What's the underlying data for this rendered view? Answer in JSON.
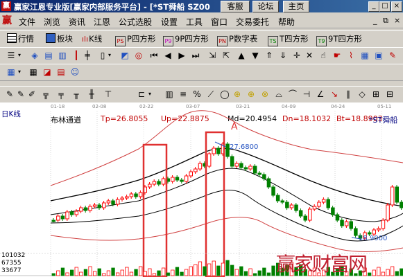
{
  "window": {
    "title": "赢家江恩专业版[赢家内部服务平台] - [*ST舜船   SZ00",
    "title_buttons": [
      "客服",
      "论坛",
      "主页"
    ],
    "window_controls": [
      "_",
      "□",
      "×"
    ]
  },
  "menu": {
    "items": [
      "文件",
      "浏览",
      "资讯",
      "江恩",
      "公式选股",
      "设置",
      "工具",
      "窗口",
      "交易委托",
      "帮助"
    ],
    "window_controls": [
      "_",
      "⧉",
      "×"
    ]
  },
  "toolbar1": {
    "items": [
      {
        "icon": "grid-icon",
        "label": "行情"
      },
      {
        "icon": "blocks-icon",
        "label": "板块"
      },
      {
        "icon": "kline-icon",
        "label": "K线"
      },
      {
        "icon": "ps-icon",
        "badge": "PS",
        "label": "P四方形"
      },
      {
        "icon": "p9-icon",
        "badge": "P9",
        "label": "9P四方形"
      },
      {
        "icon": "pn-icon",
        "badge": "PN",
        "label": "P数字表"
      },
      {
        "icon": "ts-icon",
        "badge": "TS",
        "label": "T四方形"
      },
      {
        "icon": "t9-icon",
        "badge": "T9",
        "label": "9T四方形"
      }
    ]
  },
  "chart": {
    "period_label": "日K线",
    "dates": [
      "01-18",
      "02-08",
      "02-22",
      "03-07",
      "03-21",
      "04-09",
      "04-24",
      "05-11"
    ],
    "indicator_name": "布林通道",
    "tp": "Tp=26.8055",
    "up": "Up=22.8875",
    "md": "Md=20.4954",
    "dn": "Dn=18.1032",
    "bt": "Bt=18.8903",
    "stock_name": "*ST舜船",
    "high_label": "27.6800",
    "low_label": "18.9000",
    "annotation": "A",
    "volume_ticks": [
      "101032",
      "67355",
      "33677"
    ],
    "watermark": "赢家财富网",
    "colors": {
      "up": "#008000",
      "down": "#ff0000",
      "mid": "#000000",
      "highlight_box": "#e03030"
    }
  }
}
